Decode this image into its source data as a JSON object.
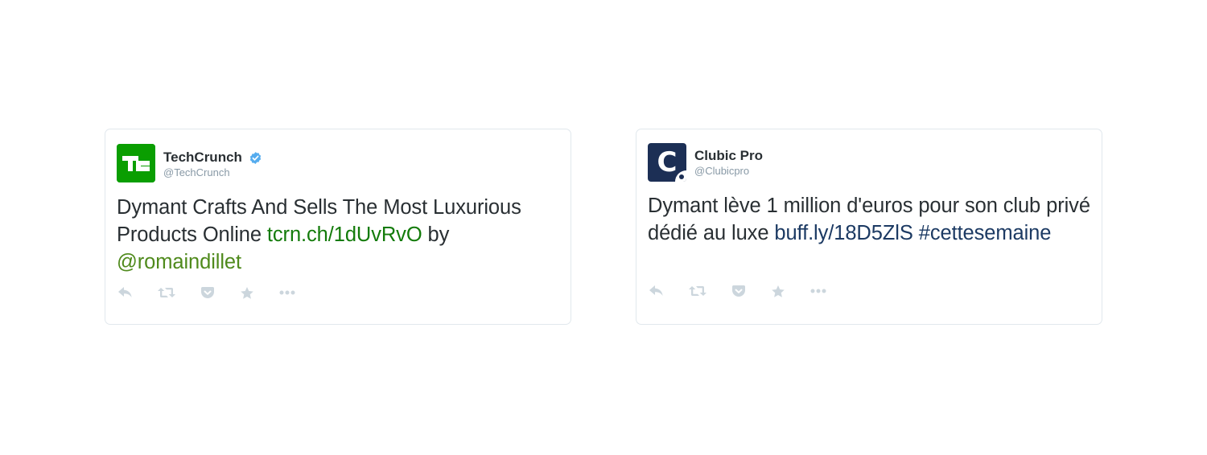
{
  "tweets": [
    {
      "author": {
        "name": "TechCrunch",
        "handle": "@TechCrunch",
        "verified": true,
        "avatar_icon": "techcrunch-logo",
        "avatar_text": "TC",
        "avatar_color": "#0a9e01"
      },
      "text": {
        "part1": "Dymant Crafts And Sells The Most Luxurious Products Online ",
        "link": "tcrn.ch/1dUvRvO",
        "part2": " by ",
        "mention": "@romaindillet"
      },
      "link_color": "#137b0a",
      "mention_color": "#4f8a1c"
    },
    {
      "author": {
        "name": "Clubic Pro",
        "handle": "@Clubicpro",
        "verified": false,
        "avatar_icon": "clubic-pro-logo",
        "avatar_letter": "C",
        "avatar_color": "#1c2f55"
      },
      "text": {
        "part1": "Dymant lève 1 million d'euros pour son club privé dédié au luxe ",
        "link": "buff.ly/18D5ZlS",
        "part2": " ",
        "hashtag": "#cettesemaine"
      },
      "link_color": "#1c3a63"
    }
  ],
  "actions": [
    {
      "name": "reply",
      "icon": "reply-icon"
    },
    {
      "name": "retweet",
      "icon": "retweet-icon"
    },
    {
      "name": "pocket",
      "icon": "pocket-icon"
    },
    {
      "name": "favorite",
      "icon": "star-icon"
    },
    {
      "name": "more",
      "icon": "more-icon"
    }
  ],
  "colors": {
    "text": "#292f33",
    "muted": "#8899a6",
    "icons": "#ccd6dd",
    "border": "#e1e8ed",
    "verified": "#55acee"
  }
}
